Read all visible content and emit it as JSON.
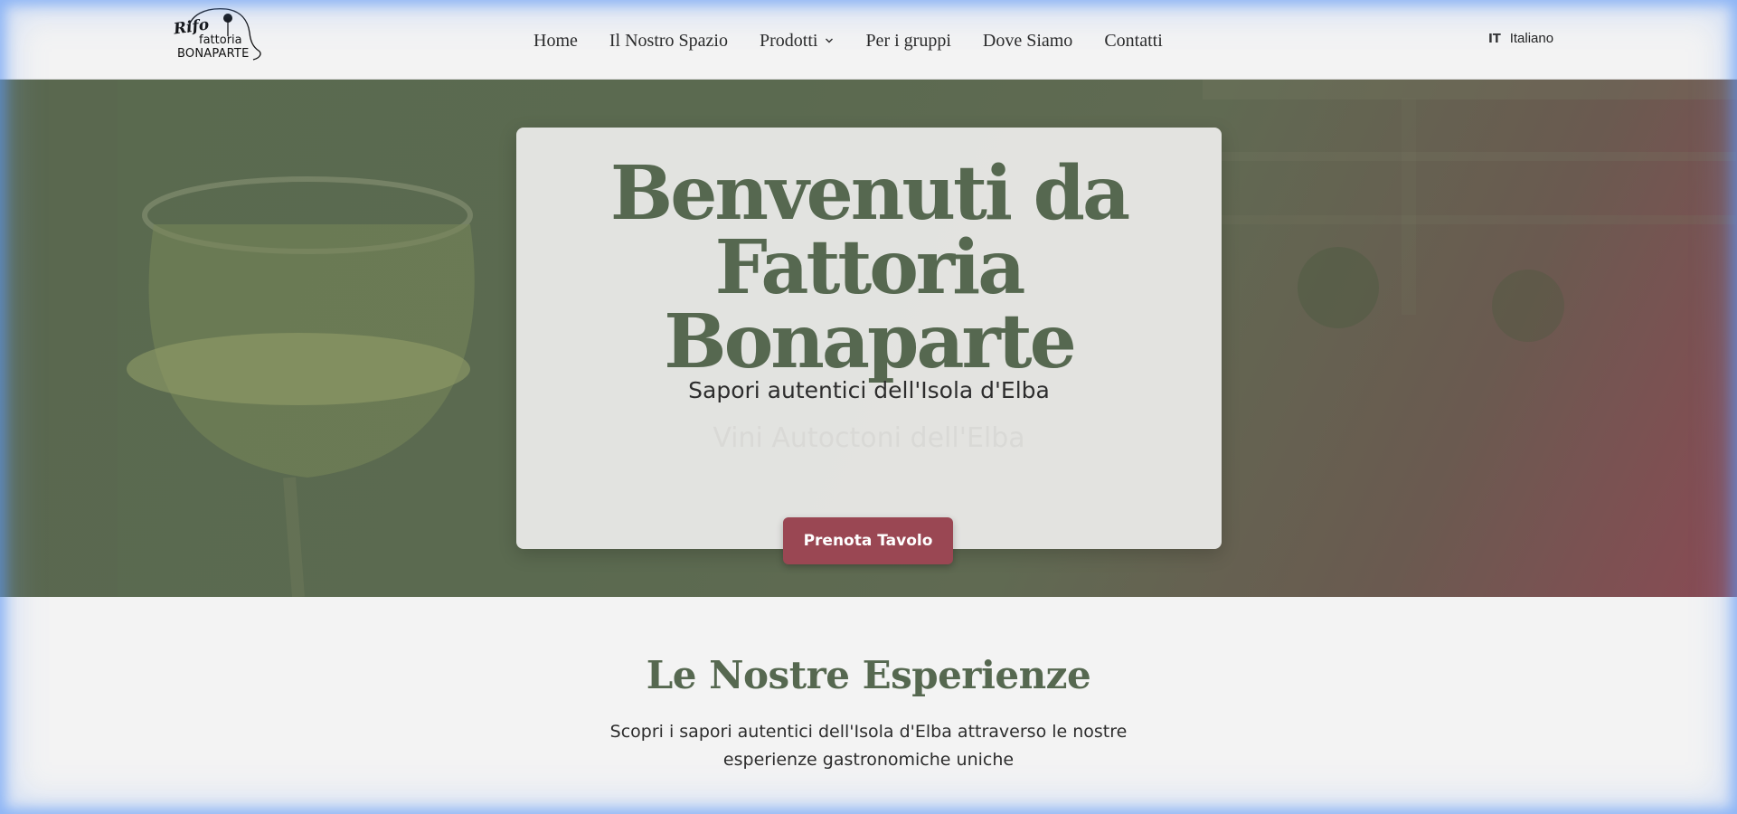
{
  "header": {
    "logo": {
      "script": "Rifo",
      "line1": "fattoria",
      "line2": "BONAPARTE"
    },
    "nav": [
      {
        "label": "Home"
      },
      {
        "label": "Il Nostro Spazio"
      },
      {
        "label": "Prodotti",
        "has_dropdown": true
      },
      {
        "label": "Per i gruppi"
      },
      {
        "label": "Dove Siamo"
      },
      {
        "label": "Contatti"
      }
    ],
    "language": {
      "code": "IT",
      "label": "Italiano"
    }
  },
  "hero": {
    "title_line1": "Benvenuti da",
    "title_line2": "Fattoria Bonaparte",
    "subtitle": "Sapori autentici dell'Isola d'Elba",
    "tagline": "Vini Autoctoni dell'Elba",
    "cta_label": "Prenota Tavolo"
  },
  "experiences": {
    "title": "Le Nostre Esperienze",
    "description": "Scopri i sapori autentici dell'Isola d'Elba attraverso le nostre esperienze gastronomiche uniche"
  },
  "colors": {
    "brand_green": "#566850",
    "brand_wine": "#9a4753",
    "background": "#f3f3f3"
  },
  "icons": {
    "dropdown": "chevron-down-icon"
  }
}
